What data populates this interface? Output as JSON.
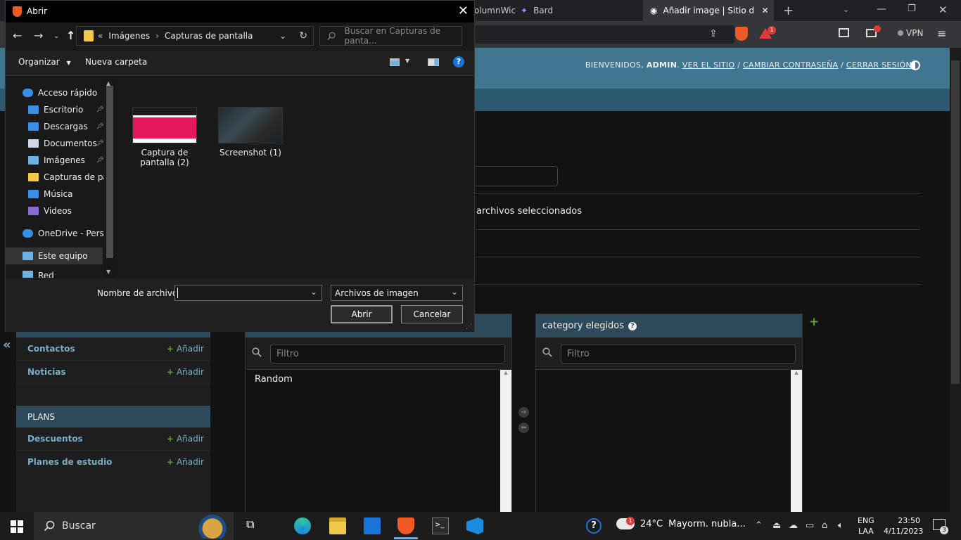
{
  "browser": {
    "tabs": [
      {
        "label": "olumnWic"
      },
      {
        "label": "Bard"
      },
      {
        "label": "Añadir image | Sitio de"
      }
    ],
    "vpn_label": "VPN",
    "notification_count": "1"
  },
  "admin": {
    "user_tools": {
      "welcome": "BIENVENIDOS,",
      "username": "ADMIN",
      "view_site": "VER EL SITIO",
      "change_password": "CAMBIAR CONTRASEÑA",
      "logout": "CERRAR SESIÓN",
      "separator": "/"
    },
    "files_selected_text": "archivos seleccionados",
    "sidebar": {
      "collapse_glyph": "«",
      "add_label": "Añadir",
      "rows": [
        {
          "label": "Contactos"
        },
        {
          "label": "Noticias"
        }
      ],
      "plans_section": "PLANS",
      "plans_rows": [
        {
          "label": "Descuentos"
        },
        {
          "label": "Planes de estudio"
        }
      ]
    },
    "selector": {
      "filter_placeholder": "Filtro",
      "available_option": "Random",
      "chosen_title": "category elegidos"
    }
  },
  "dialog": {
    "title": "Abrir",
    "path_prefix": "«",
    "path": [
      "Imágenes",
      "Capturas de pantalla"
    ],
    "search_placeholder": "Buscar en Capturas de panta...",
    "organize_label": "Organizar",
    "new_folder_label": "Nueva carpeta",
    "nav_items": [
      {
        "label": "Acceso rápido",
        "icon": "star-icon",
        "color": "#3a8ee6"
      },
      {
        "label": "Escritorio",
        "icon": "desktop-icon",
        "color": "#3a8ee6",
        "pinned": true
      },
      {
        "label": "Descargas",
        "icon": "download-icon",
        "color": "#3a8ee6",
        "pinned": true
      },
      {
        "label": "Documentos",
        "icon": "document-icon",
        "color": "#cfd8e6",
        "pinned": true
      },
      {
        "label": "Imágenes",
        "icon": "pictures-icon",
        "color": "#6fb0e0",
        "pinned": true
      },
      {
        "label": "Capturas de pan",
        "icon": "folder-icon",
        "color": "#f3c94b"
      },
      {
        "label": "Música",
        "icon": "music-icon",
        "color": "#3a8ee6"
      },
      {
        "label": "Videos",
        "icon": "video-icon",
        "color": "#8a6ad6"
      },
      {
        "label": "OneDrive - Perso",
        "icon": "cloud-icon",
        "color": "#3a8ee6"
      },
      {
        "label": "Este equipo",
        "icon": "computer-icon",
        "color": "#6fb0e0"
      },
      {
        "label": "Red",
        "icon": "network-icon",
        "color": "#6fb0e0"
      }
    ],
    "files": [
      {
        "name": "Captura de pantalla (2)"
      },
      {
        "name": "Screenshot (1)"
      }
    ],
    "filename_label": "Nombre de archivo:",
    "filename_value": "",
    "filetype_value": "Archivos de imagen",
    "open_label": "Abrir",
    "cancel_label": "Cancelar"
  },
  "taskbar": {
    "search_label": "Buscar",
    "weather_temp": "24°C",
    "weather_text": "Mayorm. nubla...",
    "weather_badge": "1",
    "lang_1": "ENG",
    "lang_2": "LAA",
    "time": "23:50",
    "date": "4/11/2023",
    "notif_count": "3"
  },
  "colors": {
    "admin_header": "#417690",
    "link_blue": "#79aec8",
    "add_green": "#5fa225",
    "brave_orange": "#f15a24",
    "vscode_blue": "#1a8ce0"
  }
}
